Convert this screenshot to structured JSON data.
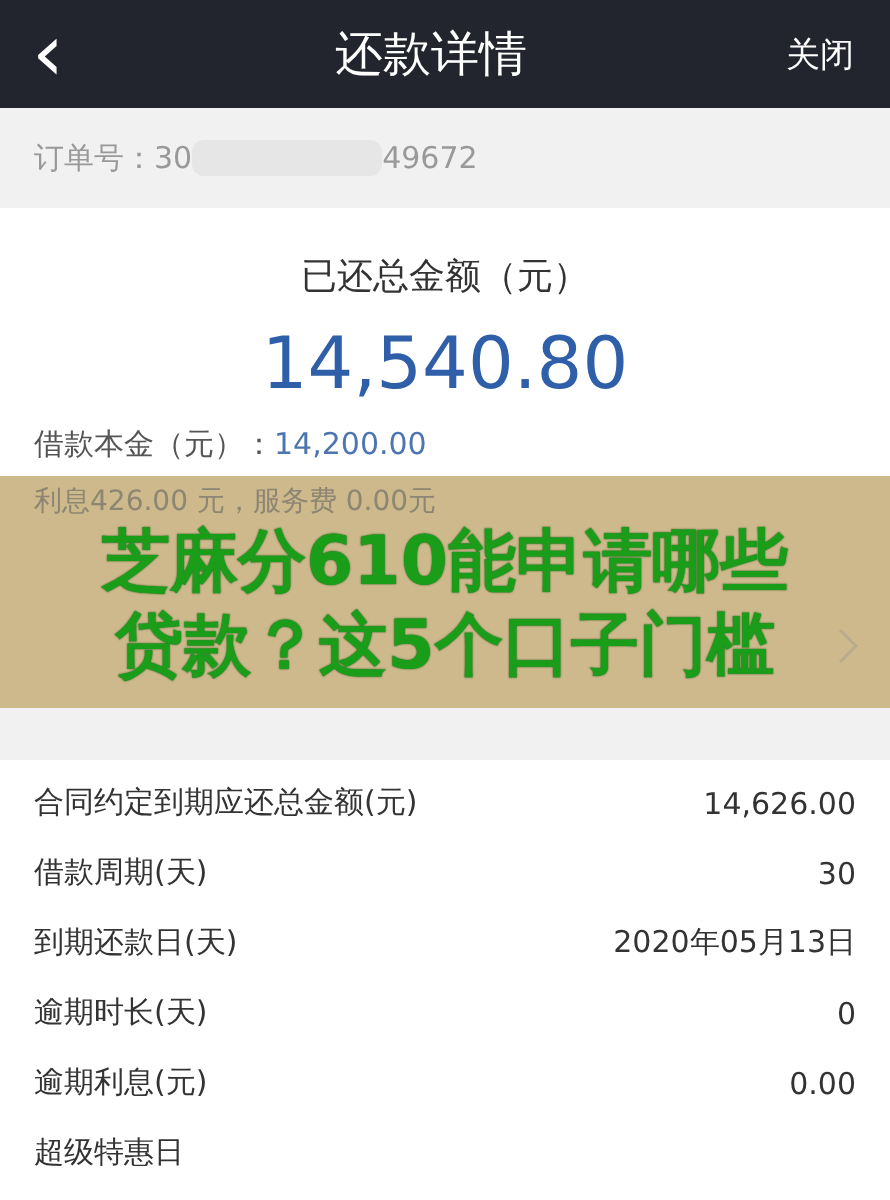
{
  "header": {
    "back": "‹",
    "title": "还款详情",
    "close": "关闭"
  },
  "order": {
    "label": "订单号：",
    "prefix": "30",
    "suffix": "49672"
  },
  "summary": {
    "title": "已还总金额（元）",
    "amount": "14,540.80",
    "principal_label": "借款本金（元）：",
    "principal_value": "14,200.00"
  },
  "banner": {
    "fee_line": "利息426.00 元，服务费 0.00元",
    "title_lines": [
      "芝麻分610能申请哪些",
      "贷款？这5个口子门槛"
    ]
  },
  "details": [
    {
      "label": "合同约定到期应还总金额(元)",
      "value": "14,626.00"
    },
    {
      "label": "借款周期(天)",
      "value": "30"
    },
    {
      "label": "到期还款日(天)",
      "value": "2020年05月13日"
    },
    {
      "label": "逾期时长(天)",
      "value": "0"
    },
    {
      "label": "逾期利息(元)",
      "value": "0.00"
    },
    {
      "label": "超级特惠日"
    }
  ]
}
